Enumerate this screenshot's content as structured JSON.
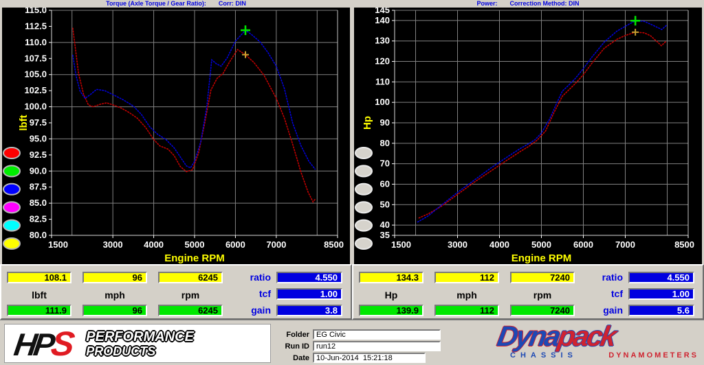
{
  "chart_data": [
    {
      "type": "line",
      "name": "torque",
      "title": "Torque (Axle Torque / Gear Ratio):",
      "correction_label": "Corr: DIN",
      "xlabel": "Engine RPM",
      "ylabel": "lbft",
      "xlim": [
        1500,
        8500
      ],
      "ylim": [
        80,
        115
      ],
      "xticks": [
        {
          "v": 1500,
          "label": "1500"
        },
        {
          "v": 3000,
          "label": "3000"
        },
        {
          "v": 4000,
          "label": "4000"
        },
        {
          "v": 5000,
          "label": "5000"
        },
        {
          "v": 6000,
          "label": "6000"
        },
        {
          "v": 7000,
          "label": "7000"
        },
        {
          "v": 8500,
          "label": "8500"
        }
      ],
      "xgrid": [
        2000,
        3000,
        4000,
        5000,
        6000,
        7000,
        8000
      ],
      "yticks": [
        {
          "v": 115,
          "label": "115.0"
        },
        {
          "v": 112.5,
          "label": "112.5"
        },
        {
          "v": 110,
          "label": "110.0"
        },
        {
          "v": 107.5,
          "label": "107.5"
        },
        {
          "v": 105,
          "label": "105.0"
        },
        {
          "v": 102.5,
          "label": "102.5"
        },
        {
          "v": 100,
          "label": "100.0"
        },
        {
          "v": 97.5,
          "label": "97.5"
        },
        {
          "v": 95,
          "label": "95.0"
        },
        {
          "v": 92.5,
          "label": "92.5"
        },
        {
          "v": 90,
          "label": "90.0"
        },
        {
          "v": 87.5,
          "label": "87.5"
        },
        {
          "v": 85,
          "label": "85.0"
        },
        {
          "v": 82.5,
          "label": "82.5"
        },
        {
          "v": 80,
          "label": "80.0"
        }
      ],
      "ygrid": [
        80,
        85,
        90,
        95,
        100,
        105,
        110,
        115
      ],
      "series": [
        {
          "name": "reference-run-torque-curve",
          "color": "#c40000",
          "points": [
            [
              2020,
              112.2
            ],
            [
              2080,
              109.2
            ],
            [
              2160,
              105.2
            ],
            [
              2280,
              102.0
            ],
            [
              2400,
              100.3
            ],
            [
              2520,
              100.0
            ],
            [
              2700,
              100.4
            ],
            [
              2850,
              100.6
            ],
            [
              3000,
              100.3
            ],
            [
              3200,
              99.8
            ],
            [
              3400,
              99.1
            ],
            [
              3600,
              98.2
            ],
            [
              3800,
              96.8
            ],
            [
              4000,
              94.9
            ],
            [
              4150,
              93.9
            ],
            [
              4350,
              93.4
            ],
            [
              4500,
              92.4
            ],
            [
              4650,
              90.7
            ],
            [
              4800,
              89.9
            ],
            [
              4950,
              90.2
            ],
            [
              5100,
              92.8
            ],
            [
              5250,
              97.5
            ],
            [
              5400,
              102.6
            ],
            [
              5550,
              104.4
            ],
            [
              5700,
              105.2
            ],
            [
              5850,
              106.9
            ],
            [
              6050,
              108.9
            ],
            [
              6245,
              108.1
            ],
            [
              6450,
              106.9
            ],
            [
              6700,
              104.9
            ],
            [
              7000,
              101.3
            ],
            [
              7200,
              98.2
            ],
            [
              7400,
              94.2
            ],
            [
              7600,
              89.9
            ],
            [
              7780,
              86.7
            ],
            [
              7900,
              85.2
            ],
            [
              7960,
              85.7
            ]
          ]
        },
        {
          "name": "current-run-torque-curve",
          "color": "#0202d8",
          "points": [
            [
              2020,
              108.0
            ],
            [
              2100,
              104.8
            ],
            [
              2200,
              102.4
            ],
            [
              2320,
              101.3
            ],
            [
              2450,
              101.9
            ],
            [
              2600,
              102.7
            ],
            [
              2800,
              102.5
            ],
            [
              3000,
              101.9
            ],
            [
              3250,
              101.1
            ],
            [
              3500,
              100.1
            ],
            [
              3700,
              98.8
            ],
            [
              3900,
              96.9
            ],
            [
              4100,
              95.7
            ],
            [
              4300,
              94.9
            ],
            [
              4500,
              93.6
            ],
            [
              4650,
              92.2
            ],
            [
              4800,
              90.8
            ],
            [
              4900,
              90.5
            ],
            [
              5000,
              91.5
            ],
            [
              5150,
              94.5
            ],
            [
              5300,
              100.0
            ],
            [
              5420,
              107.3
            ],
            [
              5530,
              106.7
            ],
            [
              5650,
              106.3
            ],
            [
              5800,
              107.6
            ],
            [
              6000,
              110.2
            ],
            [
              6245,
              111.9
            ],
            [
              6400,
              111.2
            ],
            [
              6600,
              110.1
            ],
            [
              6800,
              108.4
            ],
            [
              7000,
              106.3
            ],
            [
              7200,
              102.8
            ],
            [
              7400,
              97.5
            ],
            [
              7600,
              94.0
            ],
            [
              7800,
              91.5
            ],
            [
              7950,
              90.3
            ]
          ]
        }
      ],
      "markers": [
        {
          "name": "torque-current-cursor-marker",
          "x": 6245,
          "y": 111.9,
          "color": "#00e400",
          "size": 7,
          "w": 2.6
        },
        {
          "name": "torque-reference-cursor-marker",
          "x": 6245,
          "y": 108.1,
          "color": "#c8a030",
          "size": 5,
          "w": 2
        }
      ],
      "buttons": [
        {
          "name": "run-color-button-red",
          "color": "#ff0000"
        },
        {
          "name": "run-color-button-green",
          "color": "#00ee00"
        },
        {
          "name": "run-color-button-blue",
          "color": "#0000ff"
        },
        {
          "name": "run-color-button-magenta",
          "color": "#ff00ff"
        },
        {
          "name": "run-color-button-cyan",
          "color": "#00ffff"
        },
        {
          "name": "run-color-button-yellow",
          "color": "#ffff00"
        }
      ],
      "button_ring": "#b8b8b8"
    },
    {
      "type": "line",
      "name": "power",
      "title": "Power:",
      "correction_label": "Correction Method: DIN",
      "xlabel": "Engine RPM",
      "ylabel": "Hp",
      "xlim": [
        1500,
        8500
      ],
      "ylim": [
        35,
        145
      ],
      "xticks": [
        {
          "v": 1500,
          "label": "1500"
        },
        {
          "v": 3000,
          "label": "3000"
        },
        {
          "v": 4000,
          "label": "4000"
        },
        {
          "v": 5000,
          "label": "5000"
        },
        {
          "v": 6000,
          "label": "6000"
        },
        {
          "v": 7000,
          "label": "7000"
        },
        {
          "v": 8500,
          "label": "8500"
        }
      ],
      "xgrid": [
        2000,
        3000,
        4000,
        5000,
        6000,
        7000,
        8000
      ],
      "yticks": [
        {
          "v": 145,
          "label": "145"
        },
        {
          "v": 140,
          "label": "140"
        },
        {
          "v": 130,
          "label": "130"
        },
        {
          "v": 120,
          "label": "120"
        },
        {
          "v": 110,
          "label": "110"
        },
        {
          "v": 100,
          "label": "100"
        },
        {
          "v": 90,
          "label": "90"
        },
        {
          "v": 80,
          "label": "80"
        },
        {
          "v": 70,
          "label": "70"
        },
        {
          "v": 60,
          "label": "60"
        },
        {
          "v": 50,
          "label": "50"
        },
        {
          "v": 40,
          "label": "40"
        },
        {
          "v": 35,
          "label": "35"
        }
      ],
      "ygrid": [
        35,
        40,
        50,
        60,
        70,
        80,
        90,
        100,
        110,
        120,
        130,
        140,
        145
      ],
      "series": [
        {
          "name": "reference-run-power-curve",
          "color": "#c40000",
          "points": [
            [
              2080,
              43.5
            ],
            [
              2300,
              45.5
            ],
            [
              2600,
              49.0
            ],
            [
              3000,
              55.0
            ],
            [
              3400,
              61.0
            ],
            [
              3800,
              66.5
            ],
            [
              4200,
              72.0
            ],
            [
              4500,
              76.0
            ],
            [
              4700,
              78.5
            ],
            [
              4900,
              81.5
            ],
            [
              5100,
              86.0
            ],
            [
              5300,
              95.0
            ],
            [
              5500,
              103.0
            ],
            [
              5650,
              106.0
            ],
            [
              5800,
              109.0
            ],
            [
              6000,
              113.5
            ],
            [
              6200,
              119.0
            ],
            [
              6500,
              126.5
            ],
            [
              6800,
              130.8
            ],
            [
              7000,
              132.7
            ],
            [
              7240,
              134.3
            ],
            [
              7450,
              134.0
            ],
            [
              7600,
              132.6
            ],
            [
              7750,
              129.8
            ],
            [
              7860,
              127.7
            ],
            [
              7980,
              130.0
            ]
          ]
        },
        {
          "name": "current-run-power-curve",
          "color": "#0202d8",
          "points": [
            [
              2050,
              41.5
            ],
            [
              2300,
              44.5
            ],
            [
              2600,
              49.5
            ],
            [
              3000,
              56.0
            ],
            [
              3400,
              62.0
            ],
            [
              3800,
              68.0
            ],
            [
              4200,
              73.5
            ],
            [
              4500,
              77.5
            ],
            [
              4700,
              79.8
            ],
            [
              4850,
              81.8
            ],
            [
              5000,
              85.0
            ],
            [
              5200,
              92.0
            ],
            [
              5350,
              99.0
            ],
            [
              5500,
              105.5
            ],
            [
              5620,
              107.8
            ],
            [
              5800,
              111.5
            ],
            [
              6000,
              116.5
            ],
            [
              6200,
              122.0
            ],
            [
              6500,
              129.5
            ],
            [
              6800,
              134.8
            ],
            [
              7000,
              137.2
            ],
            [
              7240,
              139.9
            ],
            [
              7450,
              139.6
            ],
            [
              7650,
              137.8
            ],
            [
              7870,
              135.6
            ],
            [
              8000,
              138.0
            ]
          ]
        }
      ],
      "markers": [
        {
          "name": "power-current-cursor-marker",
          "x": 7240,
          "y": 139.9,
          "color": "#00e400",
          "size": 7,
          "w": 2.6
        },
        {
          "name": "power-reference-cursor-marker",
          "x": 7240,
          "y": 134.3,
          "color": "#c8a030",
          "size": 5,
          "w": 2
        }
      ],
      "buttons": [
        {
          "name": "run-button-1",
          "color": "#d6d3cc"
        },
        {
          "name": "run-button-2",
          "color": "#d6d3cc"
        },
        {
          "name": "run-button-3",
          "color": "#d6d3cc"
        },
        {
          "name": "run-button-4",
          "color": "#d6d3cc"
        },
        {
          "name": "run-button-5",
          "color": "#d6d3cc"
        },
        {
          "name": "run-button-6",
          "color": "#d6d3cc"
        }
      ],
      "button_ring": "#ebebeb"
    }
  ],
  "tables": [
    {
      "reference_values": [
        "108.1",
        "96",
        "6245"
      ],
      "unit_labels": [
        "lbft",
        "mph",
        "rpm"
      ],
      "current_values": [
        "111.9",
        "96",
        "6245"
      ],
      "params": [
        {
          "label": "ratio",
          "value": "4.550"
        },
        {
          "label": "tcf",
          "value": "1.00"
        },
        {
          "label": "gain",
          "value": "3.8"
        }
      ]
    },
    {
      "reference_values": [
        "134.3",
        "112",
        "7240"
      ],
      "unit_labels": [
        "Hp",
        "mph",
        "rpm"
      ],
      "current_values": [
        "139.9",
        "112",
        "7240"
      ],
      "params": [
        {
          "label": "ratio",
          "value": "4.550"
        },
        {
          "label": "tcf",
          "value": "1.00"
        },
        {
          "label": "gain",
          "value": "5.6"
        }
      ]
    }
  ],
  "footer": {
    "hps": {
      "hp": "HP",
      "s": "S",
      "word1": "PERFORMANCE",
      "word2": "PRODUCTS"
    },
    "fields": [
      {
        "label": "Folder",
        "value": "EG Civic"
      },
      {
        "label": "Run ID",
        "value": "run12"
      },
      {
        "label": "Date",
        "value": "10-Jun-2014  15:21:18"
      }
    ],
    "dynapack": {
      "part1": "Dyna",
      "part2": "pack",
      "sub1": "CHASSIS",
      "sub2": "DYNAMOMETERS"
    }
  },
  "colors": {
    "window_bg": "#d4d0c8",
    "chart_bg": "#000000",
    "grid": "#828282",
    "header_text": "#0000e0",
    "axis_text": "#ffffff",
    "axis_title": "#ffff00",
    "yellow_box": "#ffff00",
    "green_box": "#00e800",
    "blue_box": "#0000e0"
  }
}
